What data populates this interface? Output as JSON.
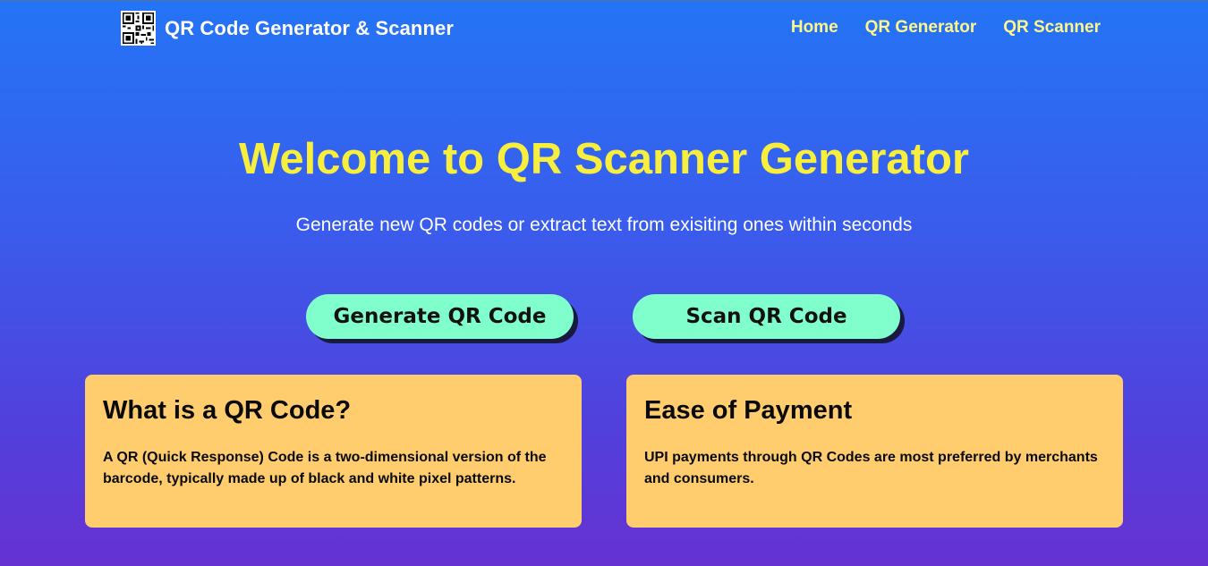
{
  "nav": {
    "brand_title": "QR Code Generator & Scanner",
    "links": [
      "Home",
      "QR Generator",
      "QR Scanner"
    ]
  },
  "hero": {
    "title": "Welcome to QR Scanner Generator",
    "subtitle": "Generate new QR codes or extract text from exisiting ones within seconds"
  },
  "buttons": {
    "generate": "Generate QR Code",
    "scan": "Scan QR Code"
  },
  "cards": [
    {
      "title": "What is a QR Code?",
      "text": "A QR (Quick Response) Code is a two-dimensional version of the barcode, typically made up of black and white pixel patterns."
    },
    {
      "title": "Ease of Payment",
      "text": "UPI payments through QR Codes are most preferred by merchants and consumers."
    }
  ],
  "colors": {
    "gradient_top": "#2474f6",
    "gradient_bottom": "#6632d2",
    "title_yellow": "#f7ee3d",
    "nav_link": "#fcf88a",
    "button_bg": "#80ffcc",
    "card_bg": "#ffcd6e"
  },
  "icons": {
    "brand_logo": "qr-code-icon"
  }
}
